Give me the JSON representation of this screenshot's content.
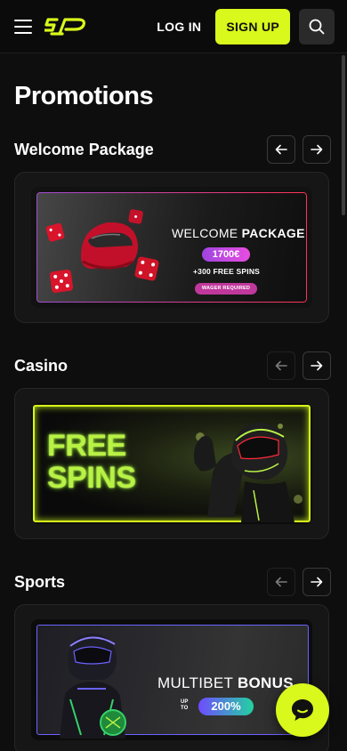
{
  "header": {
    "login_label": "LOG IN",
    "signup_label": "SIGN UP",
    "logo_text": "SP"
  },
  "page": {
    "title": "Promotions"
  },
  "sections": [
    {
      "title": "Welcome Package",
      "prev_enabled": true,
      "next_enabled": true,
      "banner": {
        "title_light": "WELCOME",
        "title_bold": "PACKAGE",
        "amount": "1700€",
        "spins": "+300 FREE SPINS",
        "note": "WAGER REQUIRED"
      }
    },
    {
      "title": "Casino",
      "prev_enabled": false,
      "next_enabled": true,
      "banner": {
        "line1": "FREE",
        "line2": "SPINS"
      }
    },
    {
      "title": "Sports",
      "prev_enabled": false,
      "next_enabled": true,
      "banner": {
        "title_light": "MULTIBET",
        "title_bold": "BONUS",
        "upto_1": "UP",
        "upto_2": "TO",
        "percent": "200%"
      }
    }
  ],
  "colors": {
    "accent": "#d9f81b",
    "background": "#0e0e0e",
    "card": "#161616"
  },
  "icons": [
    "menu-icon",
    "search-icon",
    "arrow-left-icon",
    "arrow-right-icon",
    "chat-icon"
  ]
}
